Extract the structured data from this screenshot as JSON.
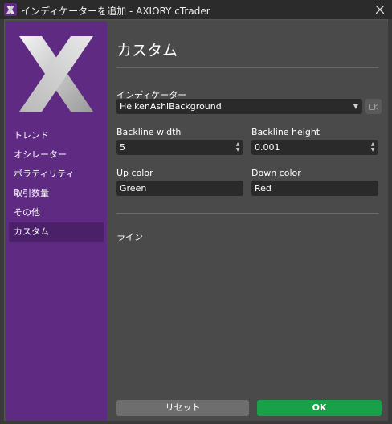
{
  "window": {
    "title": "インディケーターを追加 - AXIORY cTrader",
    "brand_color": "#5e2a82",
    "logo_icon": "axiory-x-logo"
  },
  "sidebar": {
    "items": [
      {
        "label": "トレンド",
        "active": false
      },
      {
        "label": "オシレーター",
        "active": false
      },
      {
        "label": "ボラティリティ",
        "active": false
      },
      {
        "label": "取引数量",
        "active": false
      },
      {
        "label": "その他",
        "active": false
      },
      {
        "label": "カスタム",
        "active": true
      }
    ]
  },
  "main": {
    "title": "カスタム",
    "indicator": {
      "label": "インディケーター",
      "value": "HeikenAshiBackground"
    },
    "backline_width": {
      "label": "Backline width",
      "value": "5"
    },
    "backline_height": {
      "label": "Backline height",
      "value": "0.001"
    },
    "up_color": {
      "label": "Up color",
      "value": "Green"
    },
    "down_color": {
      "label": "Down color",
      "value": "Red"
    },
    "section_line": "ライン"
  },
  "footer": {
    "reset_label": "リセット",
    "ok_label": "OK",
    "ok_color": "#19a14a"
  }
}
